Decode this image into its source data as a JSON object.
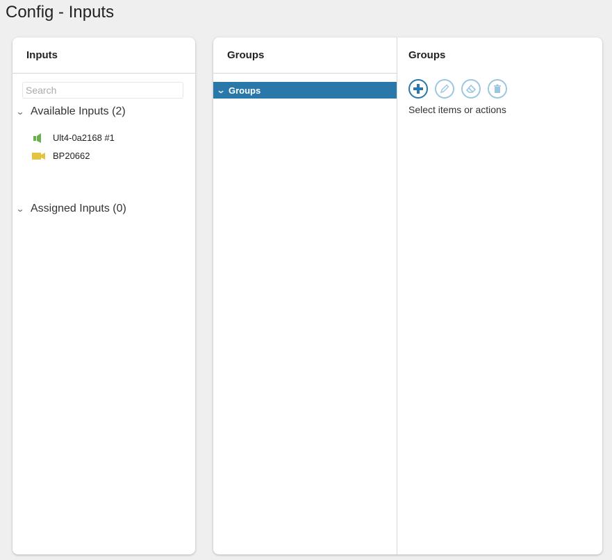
{
  "page": {
    "title": "Config - Inputs"
  },
  "inputs_panel": {
    "header": "Inputs",
    "search": {
      "placeholder": "Search",
      "value": ""
    },
    "available": {
      "label": "Available Inputs (2)",
      "items": [
        {
          "label": "Ult4-0a2168 #1",
          "icon": "audio-icon",
          "color": "#6ab04c"
        },
        {
          "label": "BP20662",
          "icon": "video-camera-icon",
          "color": "#e3c33f"
        }
      ]
    },
    "assigned": {
      "label": "Assigned Inputs (0)"
    }
  },
  "groups_panel": {
    "tree_header": "Groups",
    "tree_item": "Groups",
    "actions_header": "Groups",
    "actions": [
      {
        "name": "add-icon",
        "enabled": true
      },
      {
        "name": "edit-icon",
        "enabled": false
      },
      {
        "name": "clear-icon",
        "enabled": false
      },
      {
        "name": "delete-icon",
        "enabled": false
      }
    ],
    "hint": "Select items or actions"
  },
  "colors": {
    "accent": "#2a78aa",
    "accent_disabled": "#9cc6e0",
    "background": "#efefef"
  }
}
